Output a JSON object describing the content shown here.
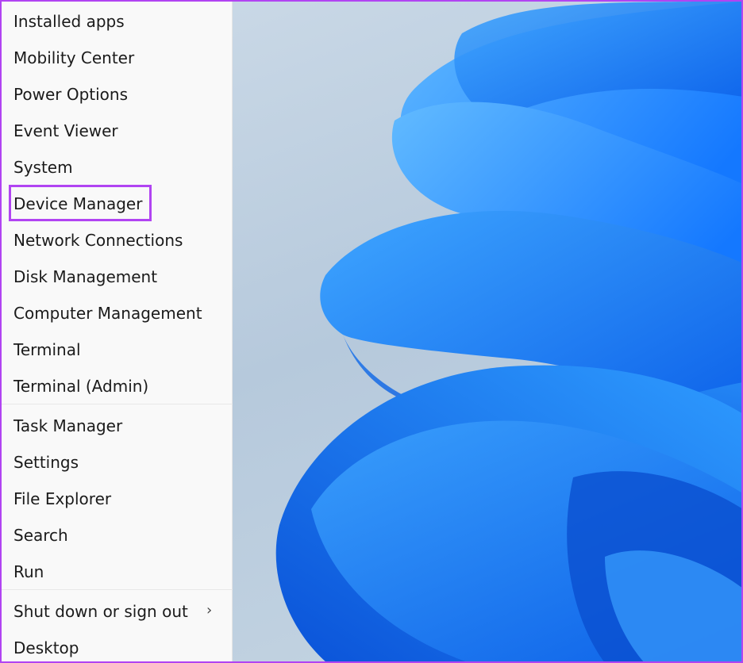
{
  "menu": {
    "items": [
      {
        "label": "Installed apps"
      },
      {
        "label": "Mobility Center"
      },
      {
        "label": "Power Options"
      },
      {
        "label": "Event Viewer"
      },
      {
        "label": "System"
      },
      {
        "label": "Device Manager"
      },
      {
        "label": "Network Connections"
      },
      {
        "label": "Disk Management"
      },
      {
        "label": "Computer Management"
      },
      {
        "label": "Terminal"
      },
      {
        "label": "Terminal (Admin)"
      },
      {
        "label": "Task Manager"
      },
      {
        "label": "Settings"
      },
      {
        "label": "File Explorer"
      },
      {
        "label": "Search"
      },
      {
        "label": "Run"
      },
      {
        "label": "Shut down or sign out"
      },
      {
        "label": "Desktop"
      }
    ],
    "submenu_icon": "chevron-right-icon",
    "highlighted_item": "Device Manager",
    "highlight_color": "#b144f2"
  },
  "wallpaper": {
    "description_icon": "windows-bloom-wallpaper",
    "colors": [
      "#0a6cff",
      "#1e8cff",
      "#55b4ff"
    ]
  }
}
